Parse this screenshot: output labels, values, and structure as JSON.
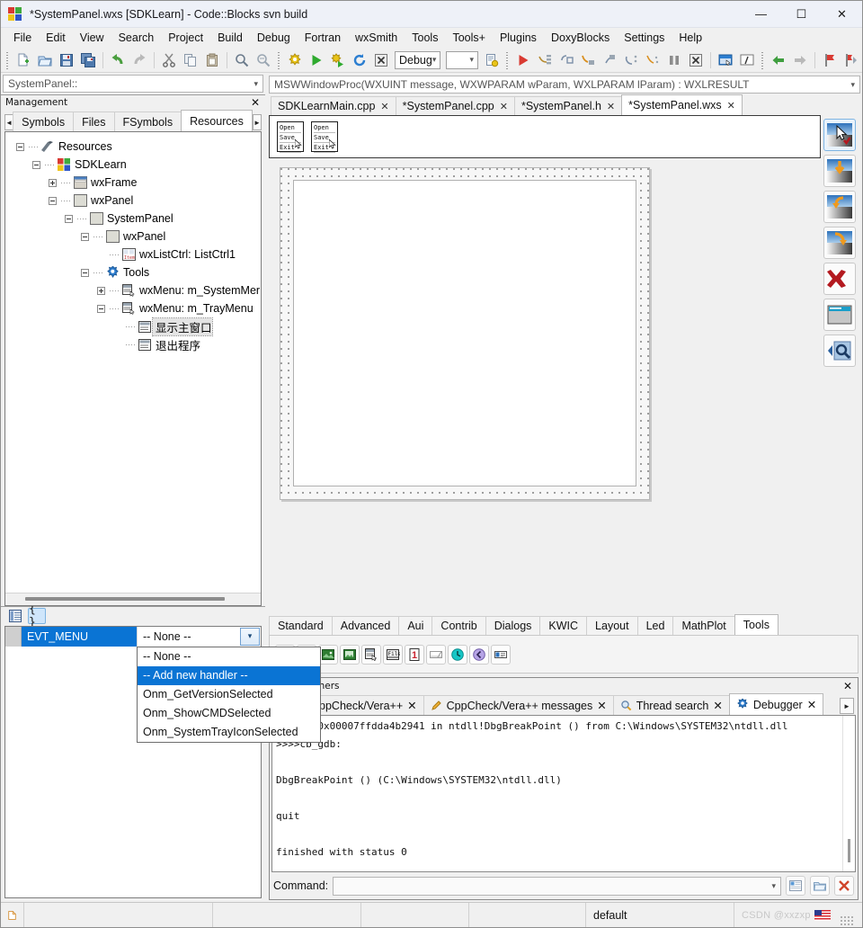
{
  "window": {
    "title": "*SystemPanel.wxs [SDKLearn] - Code::Blocks svn build",
    "minimize": "—",
    "maximize": "☐",
    "close": "✕",
    "app_icon": "codeblocks-logo-icon"
  },
  "menubar": {
    "items": [
      {
        "label": "File"
      },
      {
        "label": "Edit"
      },
      {
        "label": "View"
      },
      {
        "label": "Search"
      },
      {
        "label": "Project"
      },
      {
        "label": "Build"
      },
      {
        "label": "Debug"
      },
      {
        "label": "Fortran"
      },
      {
        "label": "wxSmith"
      },
      {
        "label": "Tools"
      },
      {
        "label": "Tools+"
      },
      {
        "label": "Plugins"
      },
      {
        "label": "DoxyBlocks"
      },
      {
        "label": "Settings"
      },
      {
        "label": "Help"
      }
    ]
  },
  "toolbar": {
    "target_combo_value": "Debug",
    "target_combo_placeholder": "",
    "second_combo_value": "",
    "icons": [
      "new-file-icon",
      "open-file-icon",
      "save-icon",
      "save-all-icon",
      "undo-icon",
      "redo-icon",
      "cut-icon",
      "copy-icon",
      "paste-icon",
      "find-icon",
      "replace-icon",
      "build-icon",
      "run-icon",
      "build-and-run-icon",
      "rebuild-icon",
      "abort-icon",
      "build-target-options-icon",
      "debug-continue-icon",
      "step-into-icon",
      "step-out-icon",
      "next-line-icon",
      "step-over-icon",
      "run-to-cursor-icon",
      "next-instruction-icon",
      "break-debugger-icon",
      "stop-debugger-icon",
      "debugging-windows-icon",
      "various-info-icon",
      "back-icon",
      "forward-icon",
      "bookmark-icon",
      "next-bookmark-icon"
    ]
  },
  "scope": {
    "value": "SystemPanel::",
    "chevron": "chevron-down-icon"
  },
  "management": {
    "title": "Management",
    "close": "✕",
    "left_arrow": "◄",
    "right_arrow": "►",
    "tabs": [
      {
        "label": "Symbols",
        "active": false
      },
      {
        "label": "Files",
        "active": false
      },
      {
        "label": "FSymbols",
        "active": false
      },
      {
        "label": "Resources",
        "active": true
      }
    ],
    "tree": [
      {
        "label": "Resources",
        "depth": 0,
        "toggle": "minus",
        "icon": "resources-icon",
        "selected": false
      },
      {
        "label": "SDKLearn",
        "depth": 1,
        "toggle": "minus",
        "icon": "project-icon",
        "selected": false
      },
      {
        "label": "wxFrame",
        "depth": 2,
        "toggle": "plus",
        "icon": "frame-icon",
        "selected": false
      },
      {
        "label": "wxPanel",
        "depth": 2,
        "toggle": "minus",
        "icon": "panel-icon",
        "selected": false
      },
      {
        "label": "SystemPanel",
        "depth": 3,
        "toggle": "minus",
        "icon": "panel-icon",
        "selected": false
      },
      {
        "label": "wxPanel",
        "depth": 4,
        "toggle": "minus",
        "icon": "panel-icon",
        "selected": false
      },
      {
        "label": "wxListCtrl: ListCtrl1",
        "depth": 5,
        "toggle": "none",
        "icon": "listctrl-icon",
        "selected": false
      },
      {
        "label": "Tools",
        "depth": 4,
        "toggle": "minus",
        "icon": "tools-gear-icon",
        "selected": false
      },
      {
        "label": "wxMenu: m_SystemMer",
        "depth": 5,
        "toggle": "plus",
        "icon": "menu-icon",
        "selected": false
      },
      {
        "label": "wxMenu: m_TrayMenu",
        "depth": 5,
        "toggle": "minus",
        "icon": "menu-icon",
        "selected": false
      },
      {
        "label": "显示主窗口",
        "depth": 6,
        "toggle": "none",
        "icon": "menuitem-icon",
        "selected": true
      },
      {
        "label": "退出程序",
        "depth": 6,
        "toggle": "none",
        "icon": "menuitem-icon",
        "selected": false
      }
    ]
  },
  "properties": {
    "toolbar": [
      {
        "name": "properties-grid-icon",
        "glyph": "▤",
        "active": false
      },
      {
        "name": "events-braces-icon",
        "glyph": "{ }",
        "active": true
      }
    ],
    "row": {
      "name": "EVT_MENU",
      "value": "-- None --",
      "chevron": "chevron-down-icon"
    },
    "dropdown_options": [
      {
        "label": "-- None --",
        "selected": false
      },
      {
        "label": "-- Add new handler --",
        "selected": true
      },
      {
        "label": "Onm_GetVersionSelected",
        "selected": false
      },
      {
        "label": "Onm_ShowCMDSelected",
        "selected": false
      },
      {
        "label": "Onm_SystemTrayIconSelected",
        "selected": false
      }
    ]
  },
  "editor": {
    "function_scope": "MSWWindowProc(WXUINT message, WXWPARAM wParam, WXLPARAM lParam) : WXLRESULT",
    "tabs": [
      {
        "label": "SDKLearnMain.cpp",
        "close": "✕",
        "active": false
      },
      {
        "label": "*SystemPanel.cpp",
        "close": "✕",
        "active": false
      },
      {
        "label": "*SystemPanel.h",
        "close": "✕",
        "active": false
      },
      {
        "label": "*SystemPanel.wxs",
        "close": "✕",
        "active": true
      }
    ],
    "menu_preview": [
      {
        "lines": [
          "Open",
          "Save",
          "Exit"
        ]
      },
      {
        "lines": [
          "Open",
          "Save",
          "Exit"
        ]
      }
    ]
  },
  "vtoolbar": {
    "buttons": [
      {
        "name": "select-tool-icon",
        "selected": true
      },
      {
        "name": "insert-into-icon",
        "selected": false
      },
      {
        "name": "insert-before-icon",
        "selected": false
      },
      {
        "name": "insert-after-icon",
        "selected": false
      },
      {
        "name": "delete-icon",
        "selected": false
      },
      {
        "name": "preview-icon",
        "selected": false
      },
      {
        "name": "quick-props-icon",
        "selected": false
      }
    ]
  },
  "palette": {
    "tabs": [
      {
        "label": "Standard",
        "active": false
      },
      {
        "label": "Advanced",
        "active": false
      },
      {
        "label": "Aui",
        "active": false
      },
      {
        "label": "Contrib",
        "active": false
      },
      {
        "label": "Dialogs",
        "active": false
      },
      {
        "label": "KWIC",
        "active": false
      },
      {
        "label": "Layout",
        "active": false
      },
      {
        "label": "Led",
        "active": false
      },
      {
        "label": "MathPlot",
        "active": false
      },
      {
        "label": "Tools",
        "active": true
      }
    ],
    "buttons": [
      {
        "name": "timer-icon",
        "glyph": "◔"
      },
      {
        "name": "sb-tool-icon",
        "glyph": "⚒"
      },
      {
        "name": "imagelist-icon",
        "glyph": "▣"
      },
      {
        "name": "imagelist2-icon",
        "glyph": "▣"
      },
      {
        "name": "menubar-icon",
        "glyph": "▤"
      },
      {
        "name": "file-icon",
        "glyph": "File"
      },
      {
        "name": "number-one-icon",
        "glyph": "1"
      },
      {
        "name": "statusbar-icon",
        "glyph": "▭"
      },
      {
        "name": "clock-teal-icon",
        "glyph": "●"
      },
      {
        "name": "clock-purple-icon",
        "glyph": "●"
      },
      {
        "name": "tooltip-icon",
        "glyph": "▬"
      }
    ]
  },
  "logs": {
    "title": "Logs & others",
    "close": "✕",
    "left_arrow": "◄",
    "right_arrow": "►",
    "tabs": [
      {
        "label": "CppCheck/Vera++",
        "icon": "pencil-icon",
        "close": "✕",
        "active": false
      },
      {
        "label": "CppCheck/Vera++ messages",
        "icon": "pencil-icon",
        "close": "✕",
        "active": false
      },
      {
        "label": "Thread search",
        "icon": "magnifier-icon",
        "close": "✕",
        "active": false
      },
      {
        "label": "Debugger",
        "icon": "gear-blue-icon",
        "close": "✕",
        "active": true
      }
    ],
    "lines": [
      "[debug]0x00007ffdda4b2941 in ntdll!DbgBreakPoint () from C:\\Windows\\SYSTEM32\\ntdll.dll",
      ">>>>cb_gdb:",
      "",
      "DbgBreakPoint () (C:\\Windows\\SYSTEM32\\ntdll.dll)",
      "",
      "quit",
      "",
      "finished with status 0"
    ],
    "command_label": "Command:",
    "command_value": "",
    "command_placeholder": "",
    "command_chevron": "chevron-down-icon",
    "command_buttons": [
      {
        "name": "debugger-window-icon",
        "glyph": "▤"
      },
      {
        "name": "open-folder-icon",
        "glyph": "▰"
      },
      {
        "name": "clear-log-icon",
        "glyph": "✕"
      }
    ]
  },
  "statusbar": {
    "cells": [
      "",
      "",
      "",
      "",
      "",
      "default"
    ],
    "icon": "document-icon",
    "watermark": "CSDN  @xxzxp",
    "watermark_flag": "us-flag-icon"
  },
  "colors": {
    "accent_blue": "#0a74d4",
    "titlebar": "#eef1f8",
    "chrome": "#f0f0f0",
    "selection": "#0a74d4",
    "red": "#cc2222",
    "orange": "#ef9a1e"
  }
}
